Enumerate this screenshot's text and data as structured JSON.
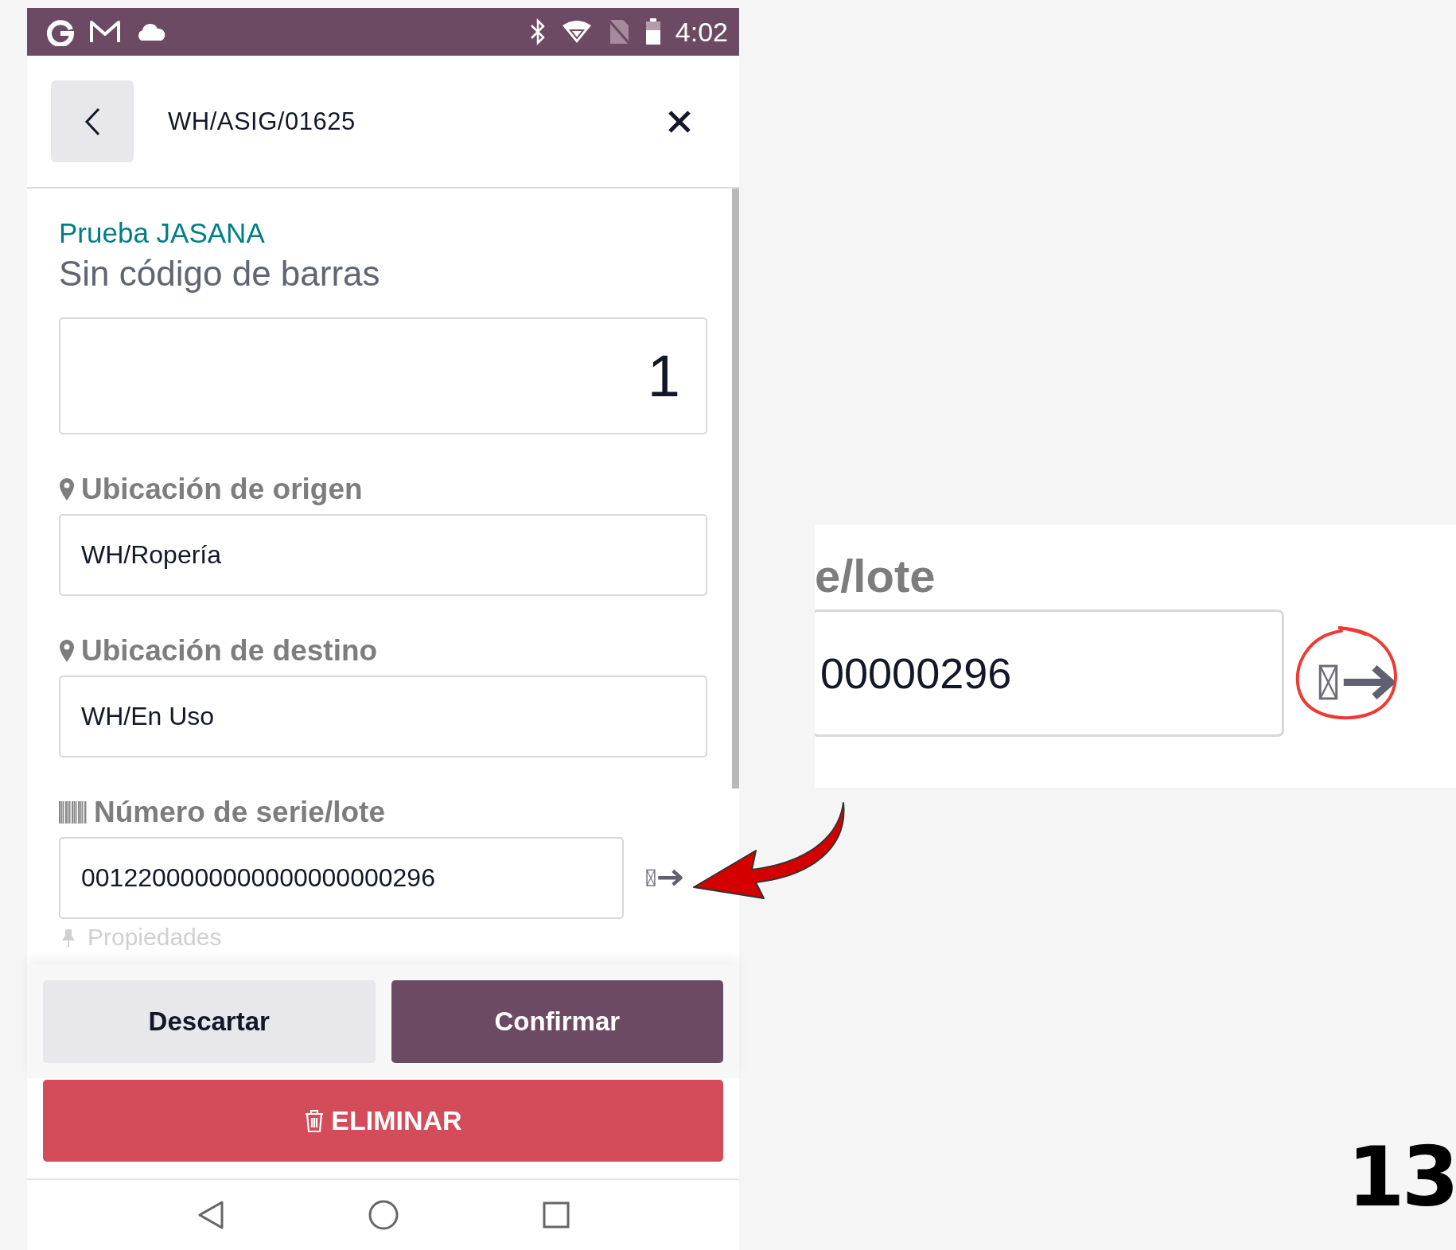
{
  "status_bar": {
    "time": "4:02"
  },
  "header": {
    "title": "WH/ASIG/01625"
  },
  "product": {
    "company": "Prueba JASANA",
    "barcode": "Sin código de barras"
  },
  "quantity": {
    "value": "1"
  },
  "fields": [
    {
      "kind": "location",
      "label": "Ubicación de origen",
      "value": "WH/Ropería"
    },
    {
      "kind": "location",
      "label": "Ubicación de destino",
      "value": "WH/En Uso"
    },
    {
      "kind": "serial",
      "label": "Número de serie/lote",
      "value": "0012200000000000000000296"
    }
  ],
  "properties_label": "Propiedades",
  "buttons": [
    {
      "kind": "secondary",
      "label": "Descartar"
    },
    {
      "kind": "primary",
      "label": "Confirmar"
    }
  ],
  "delete_button": {
    "label": "ELIMINAR"
  },
  "zoom_inset": {
    "label": "e/lote",
    "value": "00000296"
  },
  "page_number": "13"
}
